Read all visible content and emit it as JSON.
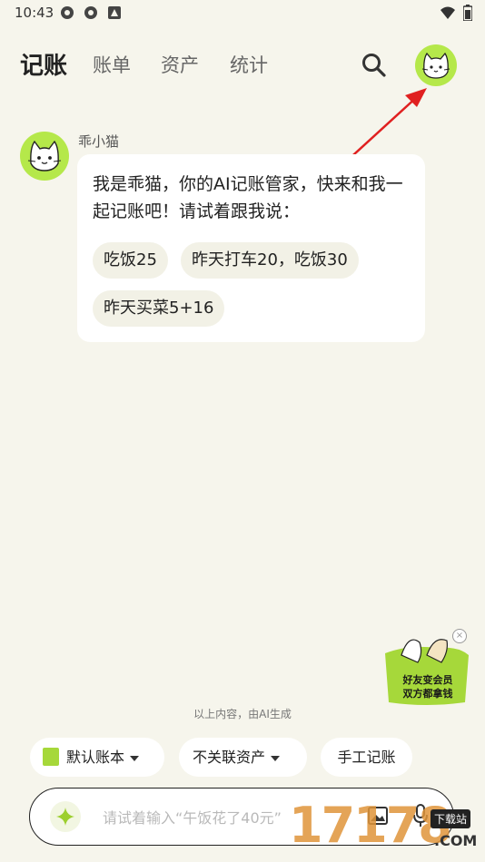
{
  "status_bar": {
    "time": "10:43",
    "icons": [
      "app-icon",
      "app-icon",
      "notification-icon",
      "wifi-icon",
      "battery-icon"
    ]
  },
  "nav": {
    "tabs": [
      {
        "label": "记账",
        "active": true
      },
      {
        "label": "账单",
        "active": false
      },
      {
        "label": "资产",
        "active": false
      },
      {
        "label": "统计",
        "active": false
      }
    ],
    "search_icon": "search-icon",
    "avatar_icon": "cat-avatar-icon"
  },
  "chat": {
    "bot_name": "乖小猫",
    "message": "我是乖猫，你的AI记账管家，快来和我一起记账吧！请试着跟我说：",
    "chips": [
      "吃饭25",
      "昨天打车20，吃饭30",
      "昨天买菜5+16"
    ]
  },
  "promo": {
    "line1": "好友变会员",
    "line2": "双方都拿钱",
    "close": "×"
  },
  "ai_note": "以上内容，由AI生成",
  "bottom_pills": {
    "book": "默认账本",
    "asset": "不关联资产",
    "manual": "手工记账"
  },
  "input": {
    "placeholder": "请试着输入“午饭花了40元”"
  },
  "watermark": {
    "digits": "17178",
    "badge": "下载站",
    "domain": ".COM"
  },
  "colors": {
    "background": "#f6f5ec",
    "accent": "#b5e84a",
    "arrow": "#e02020"
  }
}
